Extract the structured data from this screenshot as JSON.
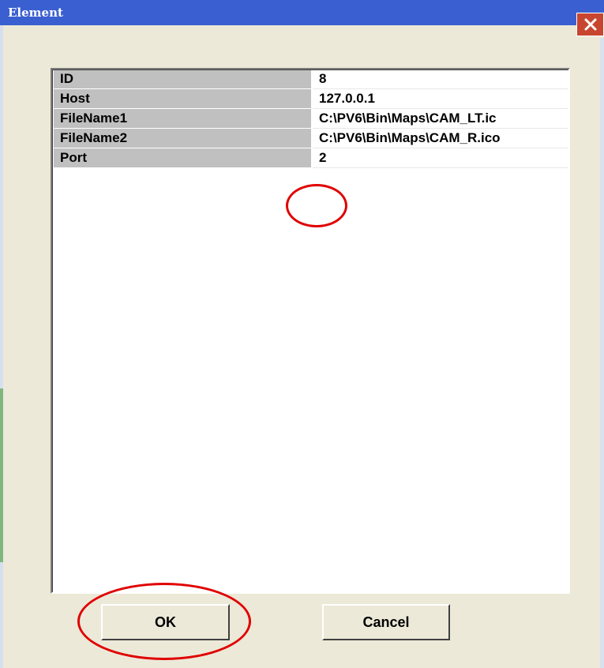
{
  "window": {
    "title": "Element",
    "close_icon": "close-icon"
  },
  "properties": [
    {
      "key": "ID",
      "value": "8"
    },
    {
      "key": "Host",
      "value": "127.0.0.1"
    },
    {
      "key": "FileName1",
      "value": "C:\\PV6\\Bin\\Maps\\CAM_LT.ic"
    },
    {
      "key": "FileName2",
      "value": "C:\\PV6\\Bin\\Maps\\CAM_R.ico"
    },
    {
      "key": "Port",
      "value": "2"
    }
  ],
  "buttons": {
    "ok_label": "OK",
    "cancel_label": "Cancel"
  },
  "colors": {
    "titlebar": "#3a5fd0",
    "dialog_face": "#ece9d8",
    "close_button": "#c84630",
    "annotation": "#e00000"
  }
}
